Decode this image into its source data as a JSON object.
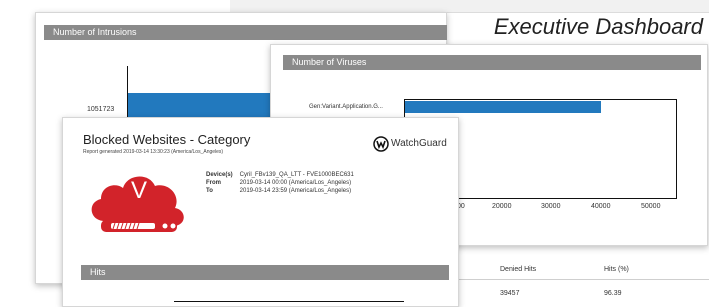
{
  "page": {
    "title": "Executive Dashboard"
  },
  "intrusions": {
    "header": "Number of Intrusions",
    "bar_label": "1051723"
  },
  "viruses": {
    "header": "Number of Viruses",
    "category": "Gen:Variant.Application.G...",
    "ticks": [
      "00",
      "20000",
      "30000",
      "40000",
      "50000"
    ]
  },
  "report": {
    "title": "Blocked Websites - Category",
    "generated": "Report generated 2019-03-14 13:30:23 (America/Los_Angeles)",
    "logo_text": "WatchGuard",
    "badge_letter": "V",
    "fields": [
      {
        "label": "Device(s)",
        "value": "Cyril_FBv139_QA_LTT - FVE1000BEC631"
      },
      {
        "label": "From",
        "value": "2019-03-14 00:00 (America/Los_Angeles)"
      },
      {
        "label": "To",
        "value": "2019-03-14 23:59 (America/Los_Angeles)"
      }
    ],
    "hits_header": "Hits"
  },
  "table": {
    "headers": [
      "Denied Hits",
      "Hits (%)"
    ],
    "row": [
      "39457",
      "96.39"
    ]
  },
  "colors": {
    "accent": "#2279be",
    "header_gray": "#8a8a8a",
    "cloud_red": "#d2232a"
  }
}
